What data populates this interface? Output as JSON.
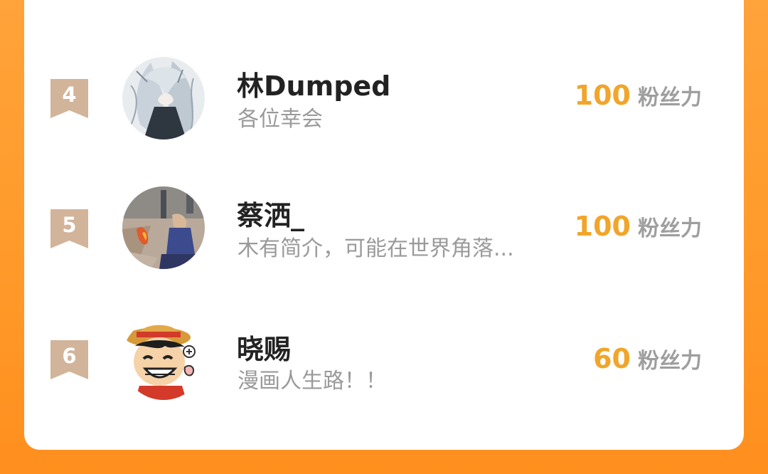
{
  "colors": {
    "background_orange": "#FF9A2A",
    "card": "#FFFFFF",
    "rank_badge": "#D2B49A",
    "score_accent": "#F1A52A",
    "name_text": "#222222",
    "bio_text": "#9A9A9A",
    "unit_text": "#9E9E9E",
    "top_avatar_ring": "#C7A23E"
  },
  "ranking": {
    "entries": [
      {
        "rank": "4",
        "name": "林Dumped",
        "bio": "各位幸会",
        "score": "100",
        "unit": "粉丝力",
        "avatar_icon": "anime-white-hair-avatar"
      },
      {
        "rank": "5",
        "name": "蔡洒_",
        "bio": "木有简介，可能在世界角落...",
        "score": "100",
        "unit": "粉丝力",
        "avatar_icon": "campfire-photo-avatar"
      },
      {
        "rank": "6",
        "name": "晓赐",
        "bio": "漫画人生路！！",
        "score": "60",
        "unit": "粉丝力",
        "avatar_icon": "straw-hat-cartoon-avatar"
      }
    ]
  }
}
